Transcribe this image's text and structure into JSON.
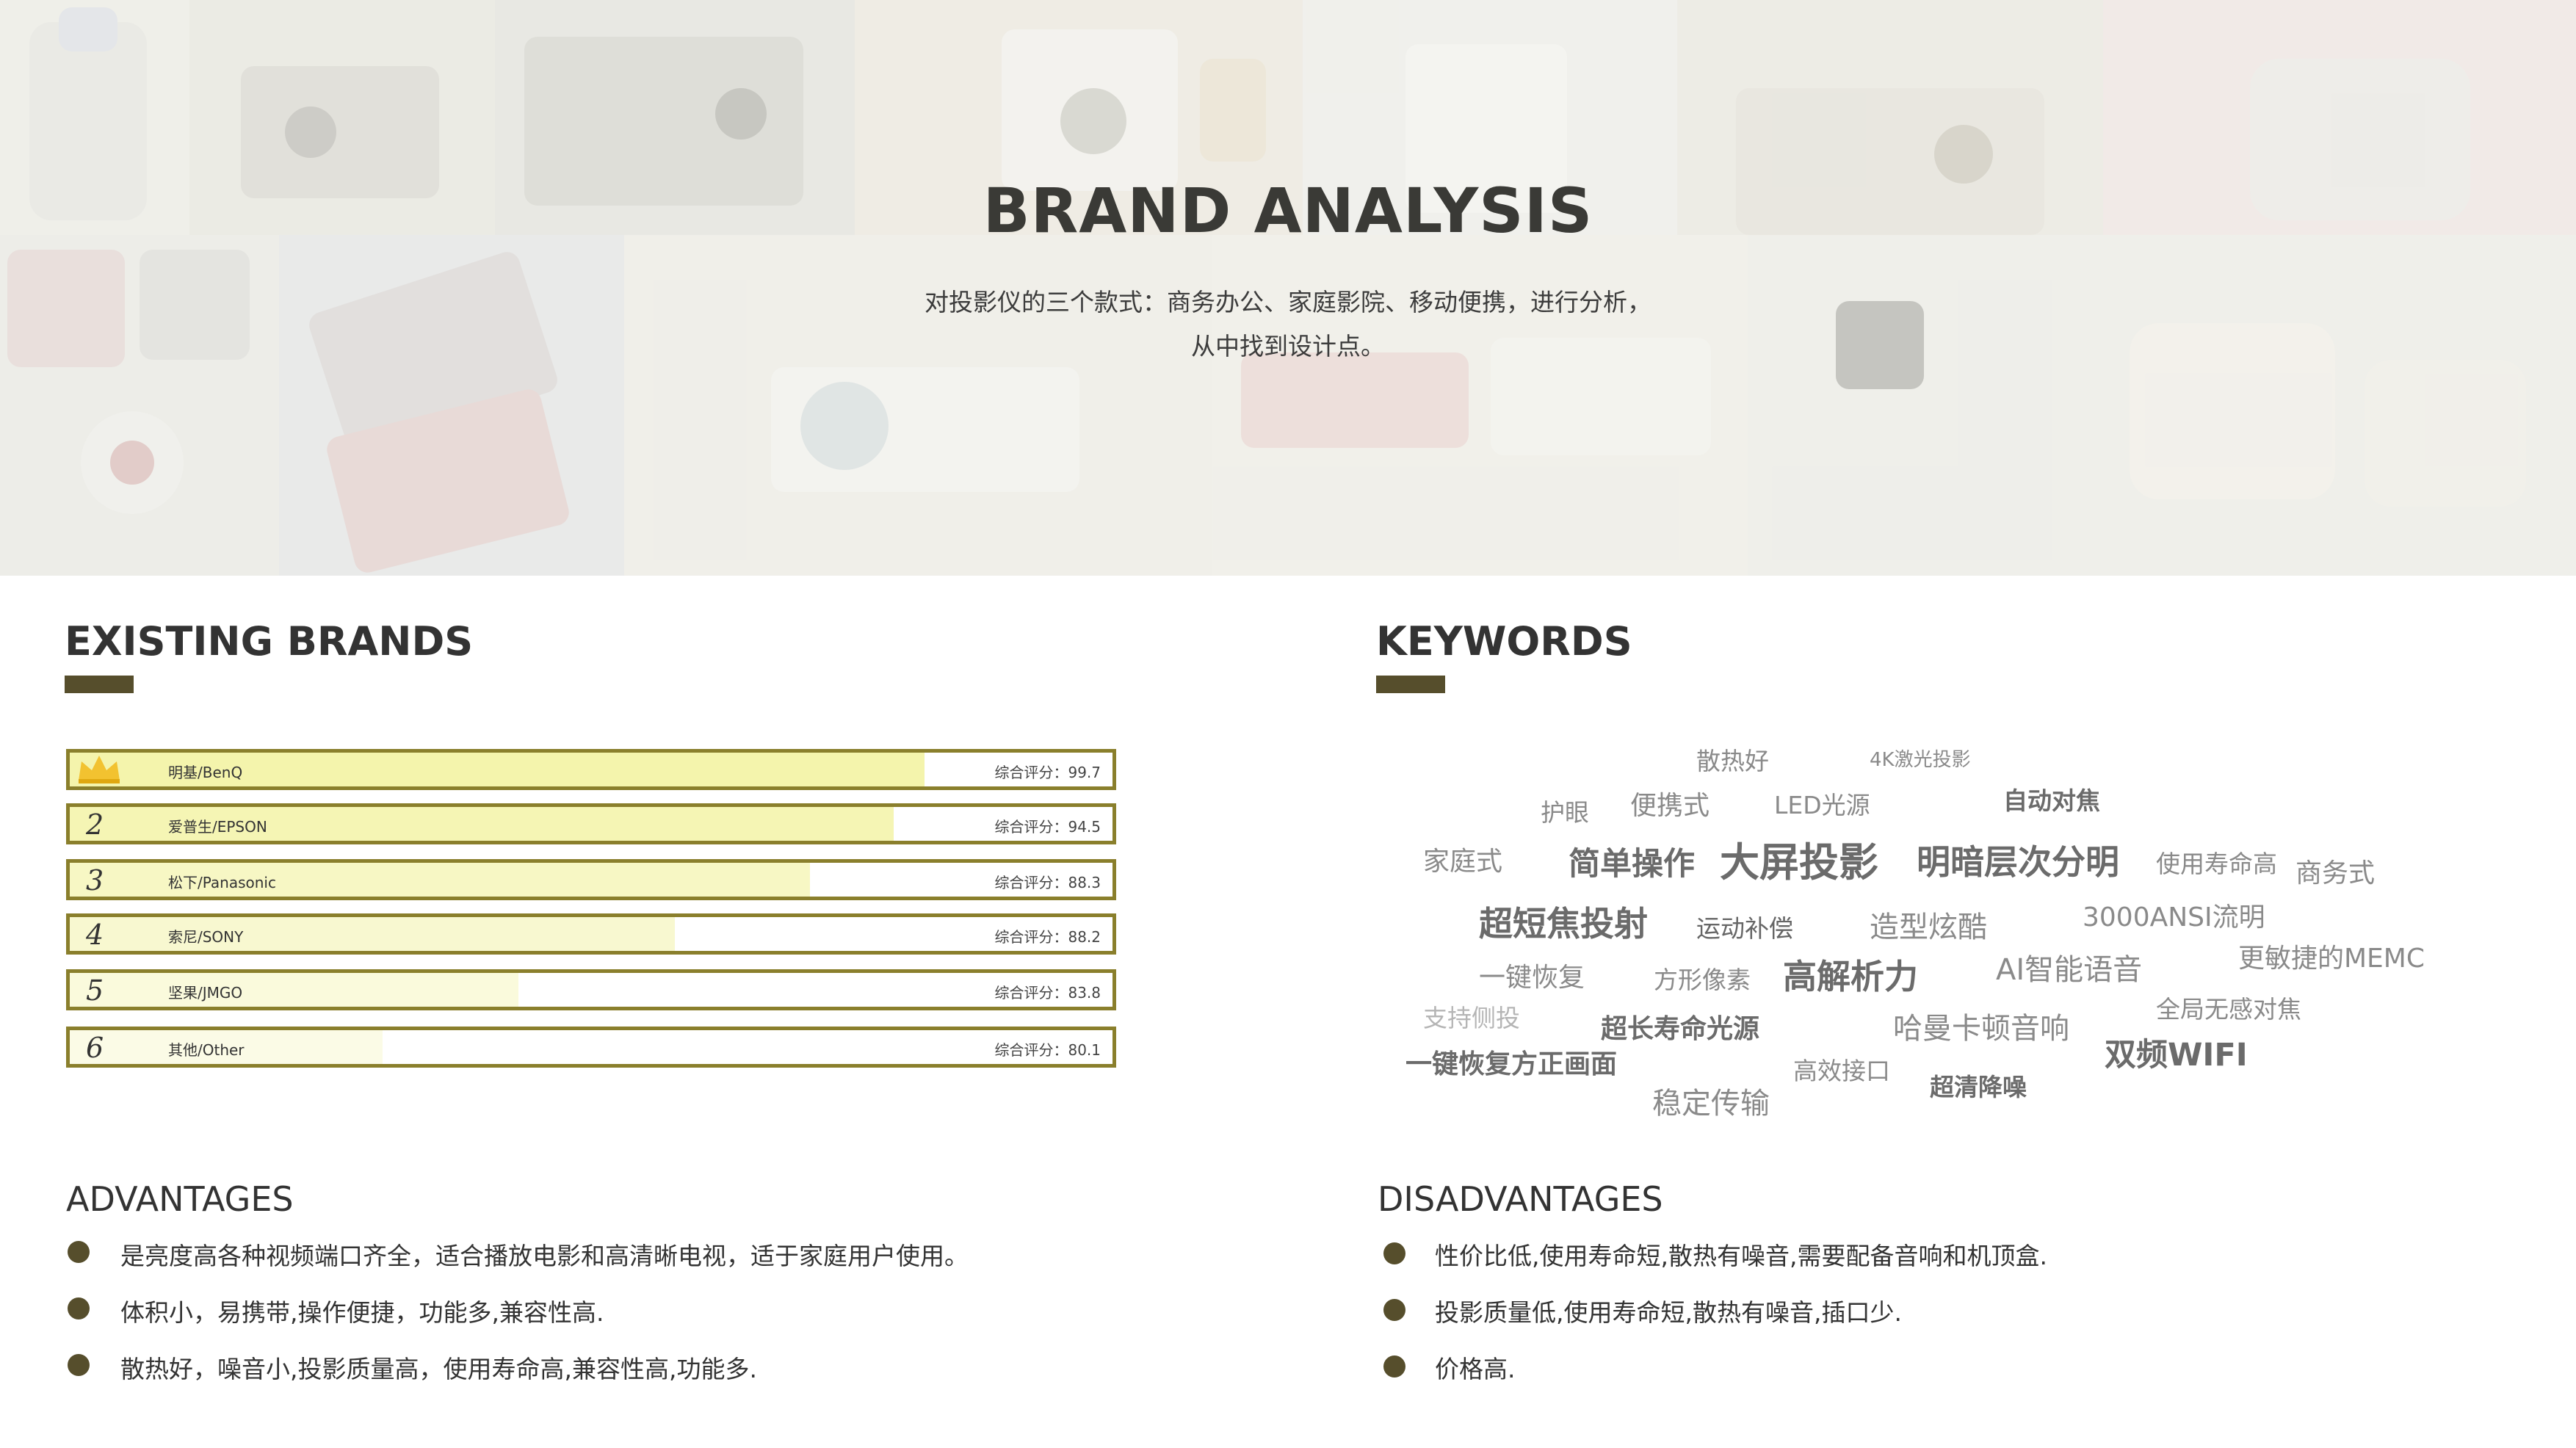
{
  "hero": {
    "title": "BRAND ANALYSIS",
    "subtitle_line1": "对投影仪的三个款式：商务办公、家庭影院、移动便携，进行分析，",
    "subtitle_line2": "从中找到设计点。"
  },
  "existing_brands": {
    "title": "EXISTING BRANDS",
    "items": [
      {
        "rank": "",
        "icon": "crown-icon",
        "name": "明基/BenQ",
        "score_text": "综合评分：99.7",
        "score": 99.7,
        "fill_fraction": 0.82,
        "fill_color": "#f4f4ac"
      },
      {
        "rank": "2",
        "name": "爱普生/EPSON",
        "score_text": "综合评分：94.5",
        "score": 94.5,
        "fill_fraction": 0.79,
        "fill_color": "#f5f5b4"
      },
      {
        "rank": "3",
        "name": "松下/Panasonic",
        "score_text": "综合评分：88.3",
        "score": 88.3,
        "fill_fraction": 0.71,
        "fill_color": "#f7f7c4"
      },
      {
        "rank": "4",
        "name": "索尼/SONY",
        "score_text": "综合评分：88.2",
        "score": 88.2,
        "fill_fraction": 0.58,
        "fill_color": "#f8f8d0"
      },
      {
        "rank": "5",
        "name": "坚果/JMGO",
        "score_text": "综合评分：83.8",
        "score": 83.8,
        "fill_fraction": 0.43,
        "fill_color": "#fafadc"
      },
      {
        "rank": "6",
        "name": "其他/Other",
        "score_text": "综合评分：80.1",
        "score": 80.1,
        "fill_fraction": 0.3,
        "fill_color": "#fbfbe6"
      }
    ]
  },
  "keywords": {
    "title": "KEYWORDS",
    "words": [
      "散热好",
      "4K激光投影",
      "护眼",
      "便携式",
      "LED光源",
      "自动对焦",
      "家庭式",
      "简单操作",
      "大屏投影",
      "明暗层次分明",
      "使用寿命高",
      "商务式",
      "超短焦投射",
      "运动补偿",
      "造型炫酷",
      "3000ANSI流明",
      "一键恢复",
      "方形像素",
      "高解析力",
      "AI智能语音",
      "更敏捷的MEMC",
      "支持侧投",
      "超长寿命光源",
      "哈曼卡顿音响",
      "全局无感对焦",
      "一键恢复方正画面",
      "高效接口",
      "双频WIFI",
      "超清降噪",
      "稳定传输"
    ]
  },
  "advantages": {
    "title": "ADVANTAGES",
    "items": [
      "是亮度高各种视频端口齐全，适合播放电影和高清晰电视，适于家庭用户使用。",
      "体积小，易携带,操作便捷，功能多,兼容性高.",
      "散热好，噪音小,投影质量高，使用寿命高,兼容性高,功能多."
    ]
  },
  "disadvantages": {
    "title": "DISADVANTAGES",
    "items": [
      "性价比低,使用寿命短,散热有噪音,需要配备音响和机顶盒.",
      "投影质量低,使用寿命短,散热有噪音,插口少.",
      "价格高."
    ]
  },
  "colors": {
    "accent": "#564e2c",
    "bar_border": "#8a7f2c",
    "crown": "#f2c230"
  }
}
